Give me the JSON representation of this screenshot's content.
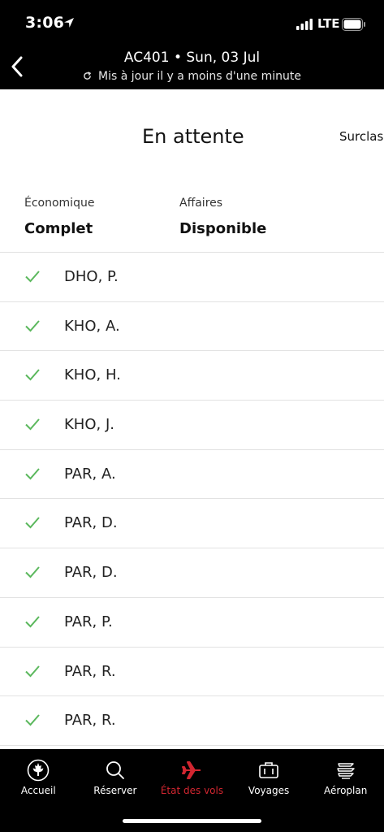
{
  "status_bar": {
    "time": "3:06",
    "network": "LTE"
  },
  "header": {
    "title": "AC401 • Sun, 03 Jul",
    "subtitle": "Mis à jour il y a moins d'une minute"
  },
  "tabs": {
    "active": "En attente",
    "next": "Surclass"
  },
  "cabins": [
    {
      "label": "Économique",
      "status": "Complet"
    },
    {
      "label": "Affaires",
      "status": "Disponible"
    }
  ],
  "passengers": [
    {
      "name": "DHO, P."
    },
    {
      "name": "KHO, A."
    },
    {
      "name": "KHO, H."
    },
    {
      "name": "KHO, J."
    },
    {
      "name": "PAR, A."
    },
    {
      "name": "PAR, D."
    },
    {
      "name": "PAR, D."
    },
    {
      "name": "PAR, P."
    },
    {
      "name": "PAR, R."
    },
    {
      "name": "PAR, R."
    }
  ],
  "tab_bar": [
    {
      "label": "Accueil",
      "icon": "maple-leaf-icon"
    },
    {
      "label": "Réserver",
      "icon": "search-icon"
    },
    {
      "label": "État des vols",
      "icon": "airplane-icon",
      "active": true
    },
    {
      "label": "Voyages",
      "icon": "suitcase-icon"
    },
    {
      "label": "Aéroplan",
      "icon": "aeroplan-icon"
    }
  ],
  "colors": {
    "check": "#5bb85d",
    "active_tab": "#d22630",
    "background": "#ffffff",
    "bars": "#000000"
  }
}
